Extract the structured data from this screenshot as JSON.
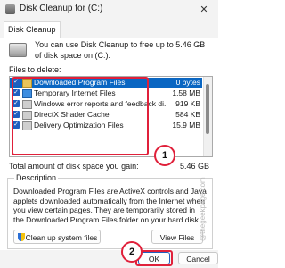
{
  "window": {
    "title": "Disk Cleanup for  (C:)",
    "close_glyph": "✕"
  },
  "tabs": [
    {
      "label": "Disk Cleanup"
    }
  ],
  "intro_text": "You can use Disk Cleanup to free up to 5.46 GB of disk space on  (C:).",
  "files_label": "Files to delete:",
  "files": [
    {
      "name": "Downloaded Program Files",
      "size": "0 bytes",
      "checked": true,
      "selected": true,
      "icon": "folder-icon"
    },
    {
      "name": "Temporary Internet Files",
      "size": "1.58 MB",
      "checked": true,
      "selected": false,
      "icon": "lock-icon"
    },
    {
      "name": "Windows error reports and feedback di...",
      "size": "919 KB",
      "checked": true,
      "selected": false,
      "icon": "document-icon"
    },
    {
      "name": "DirectX Shader Cache",
      "size": "584 KB",
      "checked": true,
      "selected": false,
      "icon": "document-icon"
    },
    {
      "name": "Delivery Optimization Files",
      "size": "15.9 MB",
      "checked": true,
      "selected": false,
      "icon": "document-icon"
    }
  ],
  "total": {
    "label": "Total amount of disk space you gain:",
    "value": "5.46 GB"
  },
  "description": {
    "title": "Description",
    "text": "Downloaded Program Files are ActiveX controls and Java applets downloaded automatically from the Internet when you view certain pages. They are temporarily stored in the Downloaded Program Files folder on your hard disk."
  },
  "buttons": {
    "cleanup_system": "Clean up system files",
    "view_files": "View Files",
    "ok": "OK",
    "cancel": "Cancel"
  },
  "annotations": {
    "step1": "1",
    "step2": "2"
  },
  "watermark": "@thegeekpage.com",
  "colors": {
    "selection": "#0a66c2",
    "annotation": "#e0203a",
    "checkbox": "#1f5fbf"
  }
}
